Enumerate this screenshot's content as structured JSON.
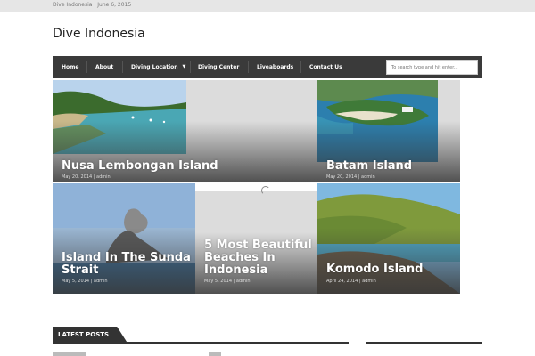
{
  "topbar": {
    "text": "Dive Indonesia | June 6, 2015"
  },
  "site": {
    "title": "Dive Indonesia"
  },
  "nav": {
    "items": [
      {
        "label": "Home"
      },
      {
        "label": "About"
      },
      {
        "label": "Diving Location",
        "caret": "▼"
      },
      {
        "label": "Diving Center"
      },
      {
        "label": "Liveaboards"
      },
      {
        "label": "Contact Us"
      }
    ],
    "search_placeholder": "To search type and hit enter..."
  },
  "featured": [
    {
      "title": "Nusa Lembongan Island",
      "meta": "May 20, 2014 | admin"
    },
    {
      "title": "Batam Island",
      "meta": "May 20, 2014 | admin"
    },
    {
      "title": "Island In The Sunda Strait",
      "meta": "May 5, 2014 | admin"
    },
    {
      "title": "5 Most Beautiful Beaches In Indonesia",
      "meta": "May 5, 2014 | admin"
    },
    {
      "title": "Komodo Island",
      "meta": "April 24, 2014 | admin"
    }
  ],
  "latest": {
    "label": "LATEST POSTS"
  },
  "colors": {
    "nav_bg": "#3a3a3a",
    "topbar_bg": "#e6e6e6",
    "tile_gray": "#dcdcdc"
  }
}
